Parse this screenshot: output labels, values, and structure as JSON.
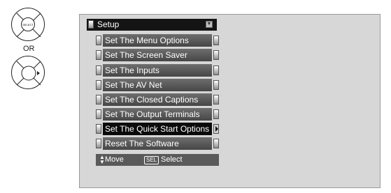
{
  "remote": {
    "select_key_label": "SELECT",
    "or_label": "OR"
  },
  "menu": {
    "title": "Setup",
    "items": [
      {
        "label": "Set The Menu Options"
      },
      {
        "label": "Set The Screen Saver"
      },
      {
        "label": "Set The Inputs"
      },
      {
        "label": "Set  The AV Net"
      },
      {
        "label": "Set The Closed Captions"
      },
      {
        "label": "Set  The Output Terminals"
      },
      {
        "label": "Set The Quick Start Options",
        "selected": true
      },
      {
        "label": "Reset The Software"
      }
    ],
    "footer": {
      "move_label": "Move",
      "sel_key": "SEL",
      "select_label": "Select"
    }
  }
}
